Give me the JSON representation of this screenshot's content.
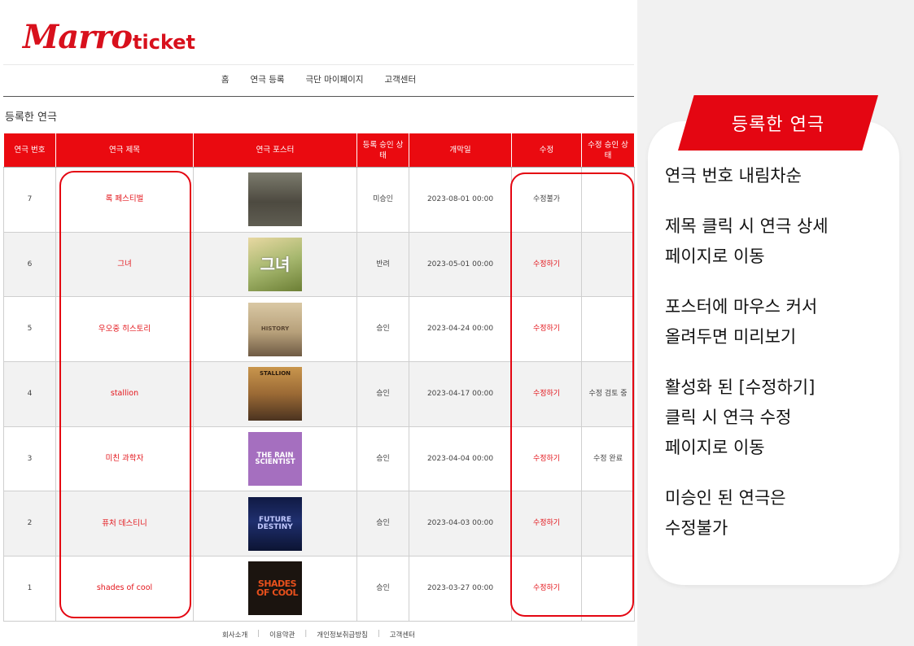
{
  "logo": {
    "brand": "Marro",
    "sub": "ticket"
  },
  "nav": [
    "홈",
    "연극 등록",
    "극단 마이페이지",
    "고객센터"
  ],
  "section_title": "등록한 연극",
  "table": {
    "headers": [
      "연극 번호",
      "연극 제목",
      "연극 포스터",
      "등록 승인 상태",
      "개막일",
      "수정",
      "수정 승인 상태"
    ],
    "rows": [
      {
        "no": "7",
        "title": "록 페스티벌",
        "poster": "7",
        "approval": "미승인",
        "date": "2023-08-01 00:00",
        "edit": "수정불가",
        "edit_enabled": false,
        "edit_status": ""
      },
      {
        "no": "6",
        "title": "그녀",
        "poster": "6",
        "approval": "반려",
        "date": "2023-05-01 00:00",
        "edit": "수정하기",
        "edit_enabled": true,
        "edit_status": ""
      },
      {
        "no": "5",
        "title": "우오중 히스토리",
        "poster": "5",
        "approval": "승인",
        "date": "2023-04-24 00:00",
        "edit": "수정하기",
        "edit_enabled": true,
        "edit_status": ""
      },
      {
        "no": "4",
        "title": "stallion",
        "poster": "4",
        "approval": "승인",
        "date": "2023-04-17 00:00",
        "edit": "수정하기",
        "edit_enabled": true,
        "edit_status": "수정 검토 중"
      },
      {
        "no": "3",
        "title": "미친 과학자",
        "poster": "3",
        "approval": "승인",
        "date": "2023-04-04 00:00",
        "edit": "수정하기",
        "edit_enabled": true,
        "edit_status": "수정 완료"
      },
      {
        "no": "2",
        "title": "퓨처 데스티니",
        "poster": "2",
        "approval": "승인",
        "date": "2023-04-03 00:00",
        "edit": "수정하기",
        "edit_enabled": true,
        "edit_status": ""
      },
      {
        "no": "1",
        "title": "shades of cool",
        "poster": "1",
        "approval": "승인",
        "date": "2023-03-27 00:00",
        "edit": "수정하기",
        "edit_enabled": true,
        "edit_status": ""
      }
    ]
  },
  "posters": {
    "7": "",
    "6": "그녀",
    "5": "HISTORY",
    "4": "STALLION",
    "3": "THE RAIN SCIENTIST",
    "2": "FUTURE DESTINY",
    "1": "SHADES OF COOL"
  },
  "footer": [
    "회사소개",
    "이용약관",
    "개인정보취급방침",
    "고객센터"
  ],
  "side_panel": {
    "badge": "등록한 연극",
    "notes": [
      "연극 번호 내림차순",
      "제목 클릭 시 연극 상세\n페이지로 이동",
      "포스터에 마우스 커서\n올려두면 미리보기",
      "활성화 된 [수정하기]\n클릭 시 연극 수정\n페이지로 이동",
      "미승인 된 연극은\n수정불가"
    ]
  },
  "colors": {
    "accent": "#e40612",
    "header_bg": "#ea0a10",
    "panel_bg": "#f1f1f1"
  }
}
